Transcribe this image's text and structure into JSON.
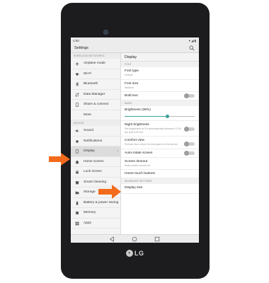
{
  "status_bar": {
    "time": "4:50"
  },
  "header": {
    "title": "Settings"
  },
  "left_pane": {
    "section_wireless": "WIRELESS NETWORKS",
    "wireless_items": [
      "Airplane mode",
      "Wi-Fi",
      "Bluetooth",
      "Data Manager",
      "Share & connect",
      "More"
    ],
    "section_device": "DEVICE",
    "device_items": [
      "Sound",
      "Notifications",
      "Display",
      "Home screen",
      "Lock screen",
      "Smart cleaning",
      "Storage",
      "Battery & power saving",
      "Memory",
      "Apps"
    ]
  },
  "right_pane": {
    "title": "Display",
    "section_font": "FONT",
    "font_type": {
      "label": "Font type",
      "value": "Default"
    },
    "font_size": {
      "label": "Font size",
      "value": "Medium"
    },
    "bold_text": {
      "label": "Bold text"
    },
    "section_basic": "BASIC",
    "brightness": {
      "label": "Brightness (36%)",
      "level": 0.36
    },
    "night_brightness": {
      "label": "Night brightness",
      "desc": "Set brightness at 0% automatically between 12:00 am and 6:00 am"
    },
    "comfort_view": {
      "label": "Comfort view",
      "desc": "Reduce blue colour for less glare on the screen"
    },
    "auto_rotate": {
      "label": "Auto-rotate screen"
    },
    "screen_timeout": {
      "label": "Screen timeout",
      "value": "Keep screen turned on"
    },
    "home_touch_buttons": {
      "label": "Home touch buttons"
    },
    "section_advanced": "ADVANCED SETTINGS",
    "display_size": {
      "label": "Display size"
    }
  },
  "brand": {
    "logo_text": "LG",
    "logo_symbol": "◐"
  },
  "colors": {
    "accent": "#3aa198",
    "callout_arrow": "#f26a1b"
  }
}
